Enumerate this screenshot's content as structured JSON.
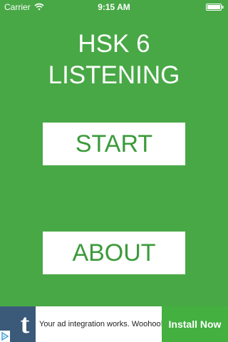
{
  "status_bar": {
    "carrier": "Carrier",
    "time": "9:15 AM",
    "icons": [
      "wifi-icon",
      "battery-icon"
    ]
  },
  "title": {
    "line1": "HSK 6",
    "line2": "LISTENING"
  },
  "menu": {
    "start_label": "START",
    "about_label": "ABOUT"
  },
  "ad": {
    "logo_letter": "t",
    "text": "Your ad integration works. Woohoo!",
    "install_label": "Install Now",
    "icons": [
      "tumblr-logo-icon",
      "adchoices-icon"
    ]
  },
  "colors": {
    "background": "#48a846",
    "button_background": "#ffffff",
    "button_text": "#3c9a3b",
    "install_button": "#43b040",
    "ad_logo_background": "#3b5a7a",
    "text_light": "#ffffff"
  }
}
